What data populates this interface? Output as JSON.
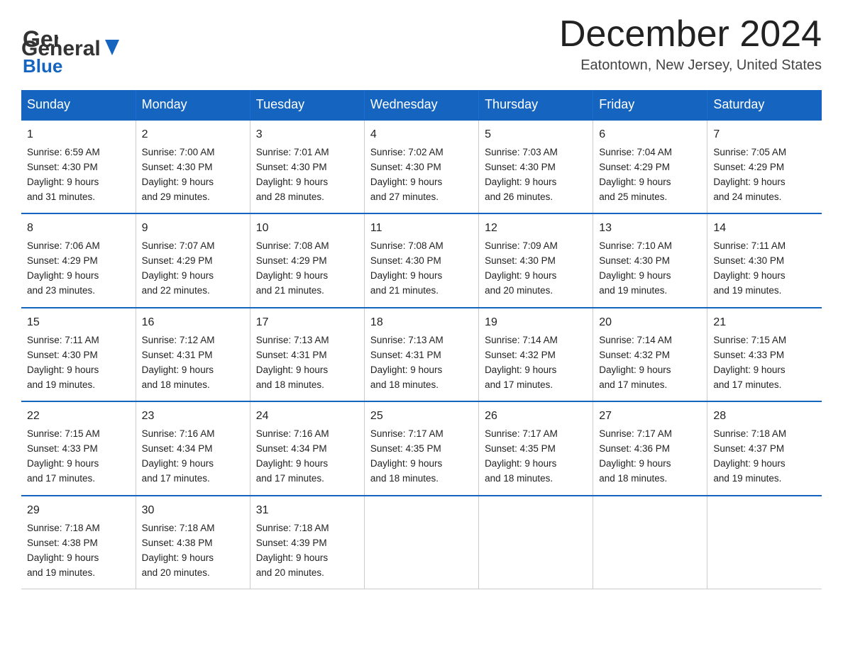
{
  "header": {
    "logo_general": "General",
    "logo_blue": "Blue",
    "month_title": "December 2024",
    "location": "Eatontown, New Jersey, United States"
  },
  "days_of_week": [
    "Sunday",
    "Monday",
    "Tuesday",
    "Wednesday",
    "Thursday",
    "Friday",
    "Saturday"
  ],
  "weeks": [
    [
      {
        "day": "1",
        "sunrise": "6:59 AM",
        "sunset": "4:30 PM",
        "daylight": "9 hours and 31 minutes."
      },
      {
        "day": "2",
        "sunrise": "7:00 AM",
        "sunset": "4:30 PM",
        "daylight": "9 hours and 29 minutes."
      },
      {
        "day": "3",
        "sunrise": "7:01 AM",
        "sunset": "4:30 PM",
        "daylight": "9 hours and 28 minutes."
      },
      {
        "day": "4",
        "sunrise": "7:02 AM",
        "sunset": "4:30 PM",
        "daylight": "9 hours and 27 minutes."
      },
      {
        "day": "5",
        "sunrise": "7:03 AM",
        "sunset": "4:30 PM",
        "daylight": "9 hours and 26 minutes."
      },
      {
        "day": "6",
        "sunrise": "7:04 AM",
        "sunset": "4:29 PM",
        "daylight": "9 hours and 25 minutes."
      },
      {
        "day": "7",
        "sunrise": "7:05 AM",
        "sunset": "4:29 PM",
        "daylight": "9 hours and 24 minutes."
      }
    ],
    [
      {
        "day": "8",
        "sunrise": "7:06 AM",
        "sunset": "4:29 PM",
        "daylight": "9 hours and 23 minutes."
      },
      {
        "day": "9",
        "sunrise": "7:07 AM",
        "sunset": "4:29 PM",
        "daylight": "9 hours and 22 minutes."
      },
      {
        "day": "10",
        "sunrise": "7:08 AM",
        "sunset": "4:29 PM",
        "daylight": "9 hours and 21 minutes."
      },
      {
        "day": "11",
        "sunrise": "7:08 AM",
        "sunset": "4:30 PM",
        "daylight": "9 hours and 21 minutes."
      },
      {
        "day": "12",
        "sunrise": "7:09 AM",
        "sunset": "4:30 PM",
        "daylight": "9 hours and 20 minutes."
      },
      {
        "day": "13",
        "sunrise": "7:10 AM",
        "sunset": "4:30 PM",
        "daylight": "9 hours and 19 minutes."
      },
      {
        "day": "14",
        "sunrise": "7:11 AM",
        "sunset": "4:30 PM",
        "daylight": "9 hours and 19 minutes."
      }
    ],
    [
      {
        "day": "15",
        "sunrise": "7:11 AM",
        "sunset": "4:30 PM",
        "daylight": "9 hours and 19 minutes."
      },
      {
        "day": "16",
        "sunrise": "7:12 AM",
        "sunset": "4:31 PM",
        "daylight": "9 hours and 18 minutes."
      },
      {
        "day": "17",
        "sunrise": "7:13 AM",
        "sunset": "4:31 PM",
        "daylight": "9 hours and 18 minutes."
      },
      {
        "day": "18",
        "sunrise": "7:13 AM",
        "sunset": "4:31 PM",
        "daylight": "9 hours and 18 minutes."
      },
      {
        "day": "19",
        "sunrise": "7:14 AM",
        "sunset": "4:32 PM",
        "daylight": "9 hours and 17 minutes."
      },
      {
        "day": "20",
        "sunrise": "7:14 AM",
        "sunset": "4:32 PM",
        "daylight": "9 hours and 17 minutes."
      },
      {
        "day": "21",
        "sunrise": "7:15 AM",
        "sunset": "4:33 PM",
        "daylight": "9 hours and 17 minutes."
      }
    ],
    [
      {
        "day": "22",
        "sunrise": "7:15 AM",
        "sunset": "4:33 PM",
        "daylight": "9 hours and 17 minutes."
      },
      {
        "day": "23",
        "sunrise": "7:16 AM",
        "sunset": "4:34 PM",
        "daylight": "9 hours and 17 minutes."
      },
      {
        "day": "24",
        "sunrise": "7:16 AM",
        "sunset": "4:34 PM",
        "daylight": "9 hours and 17 minutes."
      },
      {
        "day": "25",
        "sunrise": "7:17 AM",
        "sunset": "4:35 PM",
        "daylight": "9 hours and 18 minutes."
      },
      {
        "day": "26",
        "sunrise": "7:17 AM",
        "sunset": "4:35 PM",
        "daylight": "9 hours and 18 minutes."
      },
      {
        "day": "27",
        "sunrise": "7:17 AM",
        "sunset": "4:36 PM",
        "daylight": "9 hours and 18 minutes."
      },
      {
        "day": "28",
        "sunrise": "7:18 AM",
        "sunset": "4:37 PM",
        "daylight": "9 hours and 19 minutes."
      }
    ],
    [
      {
        "day": "29",
        "sunrise": "7:18 AM",
        "sunset": "4:38 PM",
        "daylight": "9 hours and 19 minutes."
      },
      {
        "day": "30",
        "sunrise": "7:18 AM",
        "sunset": "4:38 PM",
        "daylight": "9 hours and 20 minutes."
      },
      {
        "day": "31",
        "sunrise": "7:18 AM",
        "sunset": "4:39 PM",
        "daylight": "9 hours and 20 minutes."
      },
      null,
      null,
      null,
      null
    ]
  ],
  "labels": {
    "sunrise": "Sunrise:",
    "sunset": "Sunset:",
    "daylight": "Daylight:"
  }
}
